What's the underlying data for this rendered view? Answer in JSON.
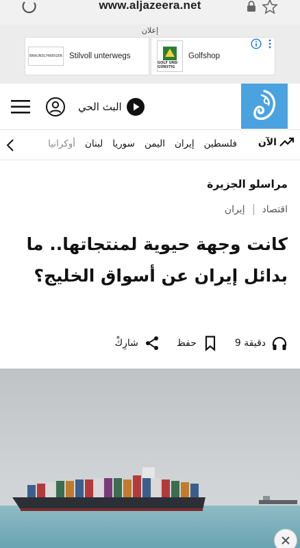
{
  "browser": {
    "url": "www.aljazeera.net"
  },
  "ad": {
    "label": "إعلان",
    "cards": [
      {
        "logo_text": "BRAUNSCHWEIGER",
        "title": "Stilvoll unterwegs"
      },
      {
        "logo_text": "GOLF UND GÜNSTIG",
        "title": "Golfshop"
      }
    ]
  },
  "header": {
    "live_label": "البث الحي"
  },
  "nav": {
    "now_label": "الآن",
    "items": [
      "فلسطين",
      "إيران",
      "اليمن",
      "سوريا",
      "لبنان",
      "أوكرانيا"
    ]
  },
  "article": {
    "author": "مراسلو الجزيرة",
    "breadcrumbs": [
      "اقتصاد",
      "إيران"
    ],
    "title": "كانت وجهة حيوية لمنتجاتها.. ما بدائل إيران عن أسواق الخليج؟",
    "read_time": "9 دقيقة",
    "save_label": "حفظ",
    "share_label": "شارِكْ"
  },
  "colors": {
    "logo_bg": "#4aa3df",
    "accent_blue": "#1a73e8"
  }
}
